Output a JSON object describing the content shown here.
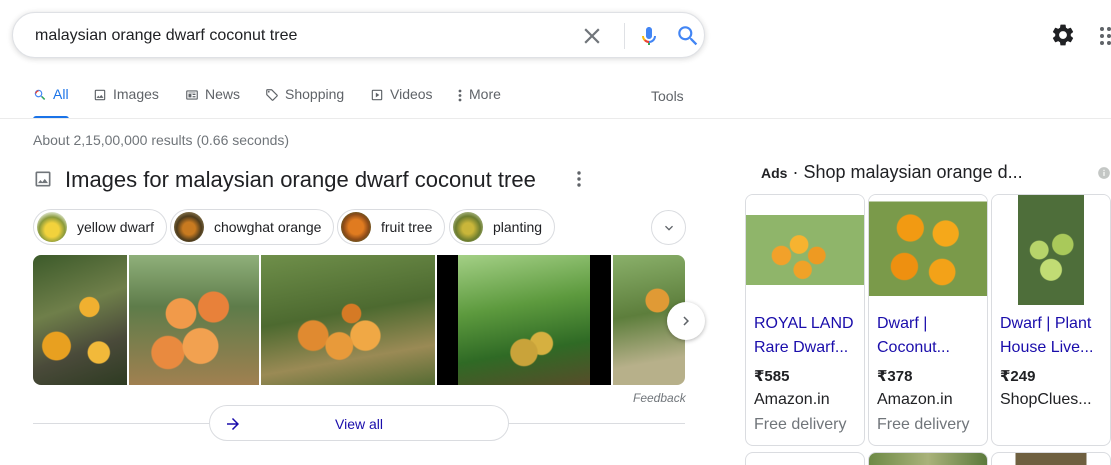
{
  "search": {
    "query": "malaysian orange dwarf coconut tree"
  },
  "tabs": [
    {
      "label": "All",
      "icon": "search-icon",
      "active": true
    },
    {
      "label": "Images",
      "icon": "image-icon"
    },
    {
      "label": "News",
      "icon": "news-icon"
    },
    {
      "label": "Shopping",
      "icon": "tag-icon"
    },
    {
      "label": "Videos",
      "icon": "video-icon"
    },
    {
      "label": "More",
      "icon": "more-vert-icon"
    }
  ],
  "tools_label": "Tools",
  "result_stats": "About 2,15,00,000 results (0.66 seconds)",
  "images_section": {
    "title": "Images for malaysian orange dwarf coconut tree",
    "chips": [
      {
        "label": "yellow dwarf"
      },
      {
        "label": "chowghat orange"
      },
      {
        "label": "fruit tree"
      },
      {
        "label": "planting"
      }
    ],
    "feedback": "Feedback",
    "view_all": "View all"
  },
  "ads": {
    "prefix": "Ads",
    "separator": " · ",
    "title": "Shop malaysian orange d...",
    "cards": [
      {
        "title_line1": "ROYAL LAND",
        "title_line2": "Rare Dwarf...",
        "price": "₹585",
        "store": "Amazon.in",
        "delivery": "Free delivery"
      },
      {
        "title_line1": "Dwarf |",
        "title_line2": "Coconut...",
        "price": "₹378",
        "store": "Amazon.in",
        "delivery": "Free delivery"
      },
      {
        "title_line1": "Dwarf | Plant",
        "title_line2": "House Live...",
        "price": "₹249",
        "store": "ShopClues...",
        "delivery": ""
      }
    ]
  },
  "colors": {
    "accent": "#1a73e8",
    "link": "#1a0dab",
    "muted": "#70757a"
  }
}
